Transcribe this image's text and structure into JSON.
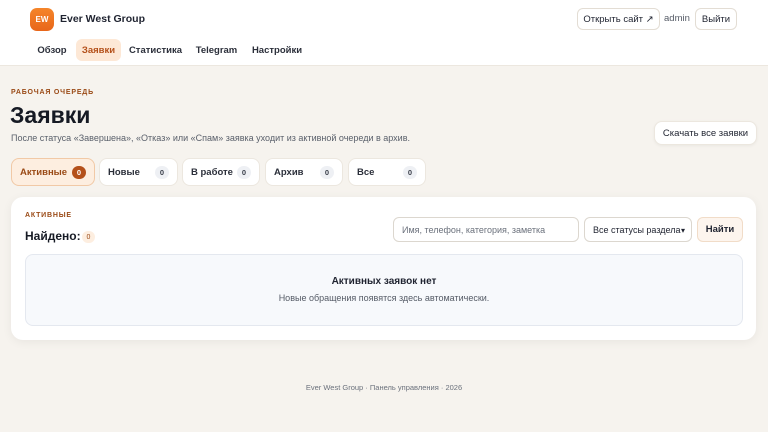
{
  "header": {
    "logo_text": "EW",
    "brand": "Ever West Group",
    "open_site": "Открыть сайт ↗",
    "user": "admin",
    "logout": "Выйти"
  },
  "nav": [
    "Обзор",
    "Заявки",
    "Статистика",
    "Telegram",
    "Настройки"
  ],
  "nav_active": "Заявки",
  "page": {
    "eyebrow": "РАБОЧАЯ ОЧЕРЕДЬ",
    "title": "Заявки",
    "subtitle": "После статуса «Завершена», «Отказ» или «Спам» заявка уходит из активной очереди в архив.",
    "download_all": "Скачать все заявки"
  },
  "tabs": [
    {
      "label": "Активные",
      "count": "0",
      "active": true
    },
    {
      "label": "Новые",
      "count": "0"
    },
    {
      "label": "В работе",
      "count": "0"
    },
    {
      "label": "Архив",
      "count": "0"
    },
    {
      "label": "Все",
      "count": "0"
    }
  ],
  "card": {
    "eyebrow": "АКТИВНЫЕ",
    "found_label": "Найдено:",
    "found_count": "0",
    "search_placeholder": "Имя, телефон, категория, заметка",
    "status_select": "Все статусы раздела",
    "find_button": "Найти",
    "empty_title": "Активных заявок нет",
    "empty_text": "Новые обращения появятся здесь автоматически."
  },
  "footer": "Ever West Group · Панель управления · 2026",
  "colors": {
    "accent": "#e8661a",
    "accent_dark": "#b4501a",
    "background": "#f6f3ee"
  }
}
